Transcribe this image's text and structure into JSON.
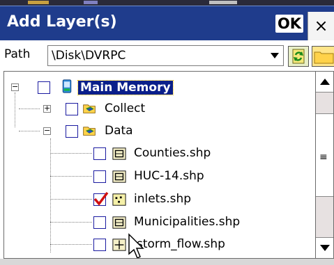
{
  "dialog": {
    "title": "Add Layer(s)",
    "ok_label": "OK",
    "close_label": "×"
  },
  "path": {
    "label": "Path",
    "value": "\\Disk\\DVRPC"
  },
  "tree": {
    "root": {
      "label": "Main Memory",
      "expanded": true,
      "checked": false,
      "selected": true
    },
    "folders": [
      {
        "label": "Collect",
        "expanded": false,
        "checked": false
      },
      {
        "label": "Data",
        "expanded": true,
        "checked": false
      }
    ],
    "files": [
      {
        "label": "Counties.shp",
        "checked": false,
        "icon": "polygon-layer-icon"
      },
      {
        "label": "HUC-14.shp",
        "checked": false,
        "icon": "polygon-layer-icon"
      },
      {
        "label": "inlets.shp",
        "checked": true,
        "icon": "point-layer-icon"
      },
      {
        "label": "Municipalities.shp",
        "checked": false,
        "icon": "polygon-layer-icon"
      },
      {
        "label": "storm_flow.shp",
        "checked": false,
        "icon": "line-layer-icon"
      }
    ]
  },
  "colors": {
    "titlebar": "#1f3c8c",
    "selection": "#0a1f8a",
    "checkmark": "#d01010"
  }
}
